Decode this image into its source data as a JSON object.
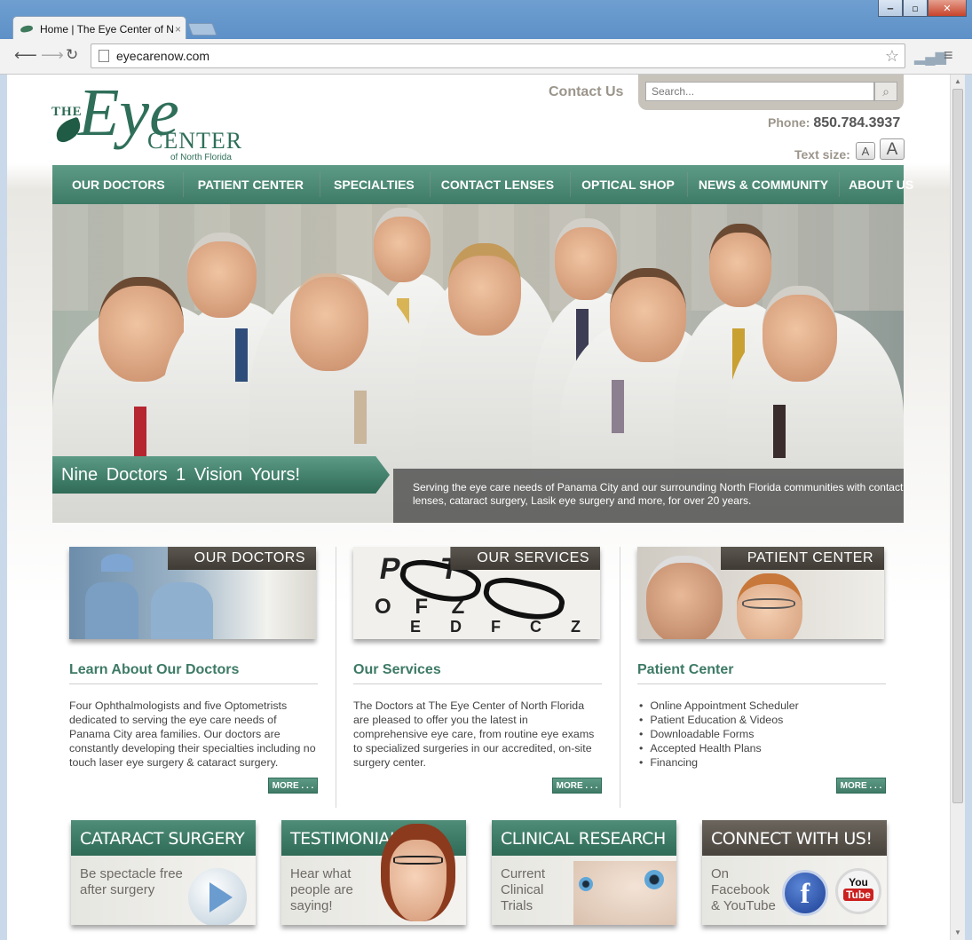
{
  "browser": {
    "tab_title": "Home | The Eye Center of N",
    "tab_close": "×",
    "url": "eyecarenow.com",
    "win_minimize": "‒",
    "win_maximize": "▫",
    "win_close": "✕"
  },
  "header": {
    "logo_the": "THE",
    "logo_eye": "Eye",
    "logo_center": "CENTER",
    "logo_sub": "of North Florida",
    "contact_label": "Contact Us",
    "search_placeholder": "Search...",
    "phone_label": "Phone:",
    "phone_number": "850.784.3937",
    "text_size_label": "Text size:",
    "text_small": "A",
    "text_large": "A"
  },
  "nav": {
    "items": [
      "OUR DOCTORS",
      "PATIENT CENTER",
      "SPECIALTIES",
      "CONTACT LENSES",
      "OPTICAL SHOP",
      "NEWS & COMMUNITY",
      "ABOUT US"
    ]
  },
  "hero": {
    "banner": "Nine Doctors  1 Vision  Yours!",
    "caption": "Serving the eye care needs of Panama City and our surrounding North Florida communities with contact lenses, cataract surgery, Lasik eye surgery and more, for over 20 years."
  },
  "columns": [
    {
      "tag": "OUR DOCTORS",
      "title": "Learn About Our Doctors",
      "text": "Four Ophthalmologists and five Optometrists dedicated to serving the eye care needs of Panama City area families. Our doctors are constantly developing their specialties including no touch laser eye surgery & cataract surgery.",
      "more": "MORE . . ."
    },
    {
      "tag": "OUR SERVICES",
      "title": "Our Services",
      "text": "The Doctors at The Eye Center of North Florida are pleased to offer you the latest in comprehensive eye care, from routine eye exams to specialized surgeries in our accredited, on-site surgery center.",
      "more": "MORE . . ."
    },
    {
      "tag": "PATIENT CENTER",
      "title": "Patient Center",
      "list": [
        "Online Appointment Scheduler",
        "Patient Education & Videos",
        "Downloadable Forms",
        "Accepted Health Plans",
        "Financing"
      ],
      "more": "MORE . . ."
    }
  ],
  "promos": [
    {
      "title": "CATARACT SURGERY",
      "text": [
        "Be spectacle free",
        "after surgery"
      ]
    },
    {
      "title": "TESTIMONIALS",
      "text": [
        "Hear what",
        "people are",
        "saying!"
      ]
    },
    {
      "title": "CLINICAL RESEARCH",
      "text": [
        "Current",
        "Clinical",
        "Trials"
      ]
    },
    {
      "title": "CONNECT WITH US!",
      "text": [
        "On",
        "Facebook",
        "& YouTube"
      ]
    }
  ],
  "colors": {
    "brand_green": "#3e7b67",
    "tag_brown": "#48433c",
    "text_gray": "#444444"
  },
  "icons": [
    "search-icon",
    "star-icon",
    "facebook-icon",
    "youtube-icon",
    "play-icon"
  ]
}
